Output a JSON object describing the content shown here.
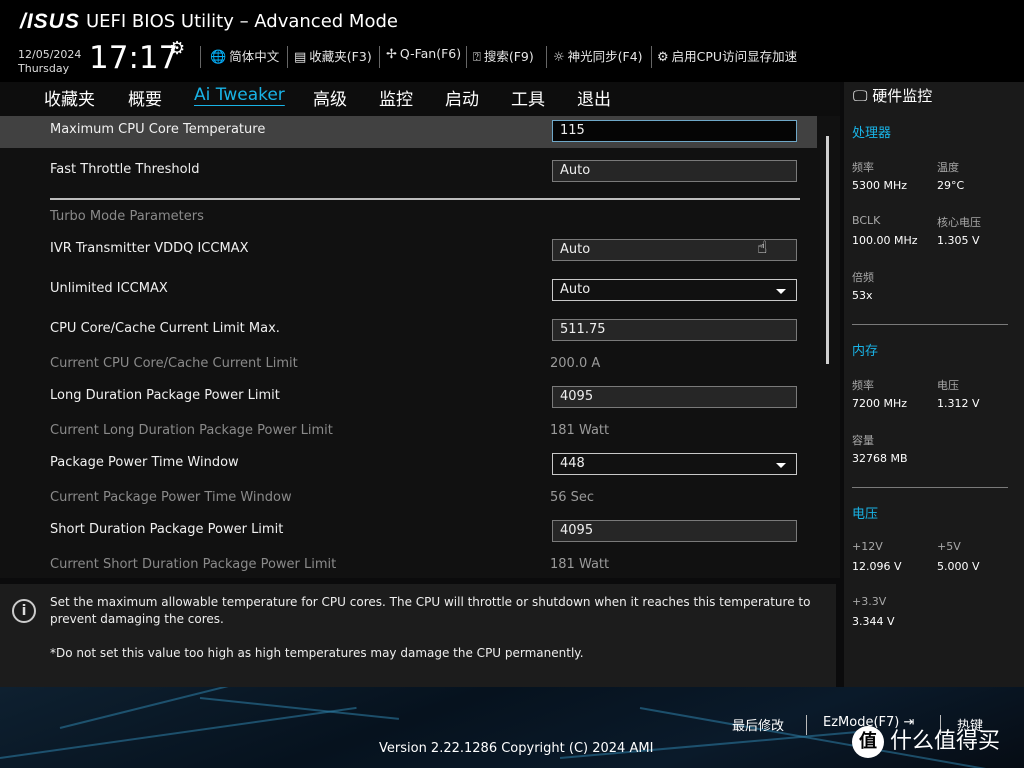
{
  "header": {
    "brand": "/ISUS",
    "title": "UEFI BIOS Utility – Advanced Mode",
    "date": "12/05/2024",
    "day": "Thursday",
    "time": "17:17",
    "tools": [
      {
        "icon": "globe-icon",
        "label": "简体中文"
      },
      {
        "icon": "favorites-icon",
        "label": "收藏夹(F3)"
      },
      {
        "icon": "fan-icon",
        "label": "Q-Fan(F6)"
      },
      {
        "icon": "help-search-icon",
        "label": "搜索(F9)"
      },
      {
        "icon": "aura-light-icon",
        "label": "神光同步(F4)"
      },
      {
        "icon": "resizable-bar-icon",
        "label": "启用CPU访问显存加速"
      }
    ]
  },
  "menu": {
    "items": [
      "收藏夹",
      "概要",
      "Ai Tweaker",
      "高级",
      "监控",
      "启动",
      "工具",
      "退出"
    ],
    "active": "Ai Tweaker"
  },
  "settings": {
    "rows": [
      {
        "label": "Maximum CPU Core Temperature",
        "value": "115"
      },
      {
        "label": "Fast Throttle Threshold",
        "value": "Auto"
      },
      {
        "label": "Turbo Mode Parameters"
      },
      {
        "label": "IVR Transmitter VDDQ ICCMAX",
        "value": "Auto"
      },
      {
        "label": "Unlimited ICCMAX",
        "value": "Auto"
      },
      {
        "label": "CPU Core/Cache Current Limit Max.",
        "value": "511.75"
      },
      {
        "label": "Current CPU Core/Cache Current Limit",
        "value": "200.0 A"
      },
      {
        "label": "Long Duration Package Power Limit",
        "value": "4095"
      },
      {
        "label": "Current Long Duration Package Power Limit",
        "value": "181 Watt"
      },
      {
        "label": "Package Power Time Window",
        "value": "448"
      },
      {
        "label": "Current Package Power Time Window",
        "value": "56 Sec"
      },
      {
        "label": "Short Duration Package Power Limit",
        "value": "4095"
      },
      {
        "label": "Current Short Duration Package Power Limit",
        "value": "181 Watt"
      }
    ]
  },
  "help": {
    "line1": "Set the maximum allowable temperature for CPU cores. The CPU will throttle or shutdown when it reaches this temperature to",
    "line2": "prevent damaging the cores.",
    "line3": "*Do not set this value too high as high temperatures may damage the CPU permanently."
  },
  "hardware": {
    "title": "硬件监控",
    "cpu": {
      "title": "处理器",
      "freq_label": "频率",
      "freq": "5300 MHz",
      "temp_label": "温度",
      "temp": "29°C",
      "bclk_label": "BCLK",
      "bclk": "100.00 MHz",
      "vcore_label": "核心电压",
      "vcore": "1.305 V",
      "ratio_label": "倍频",
      "ratio": "53x"
    },
    "memory": {
      "title": "内存",
      "freq_label": "频率",
      "freq": "7200 MHz",
      "volt_label": "电压",
      "volt": "1.312 V",
      "cap_label": "容量",
      "cap": "32768 MB"
    },
    "voltage": {
      "title": "电压",
      "v12_label": "+12V",
      "v12": "12.096 V",
      "v5_label": "+5V",
      "v5": "5.000 V",
      "v33_label": "+3.3V",
      "v33": "3.344 V"
    }
  },
  "footer": {
    "last_modified": "最后修改",
    "ezmode": "EzMode(F7)",
    "hotkeys": "热键",
    "version": "Version 2.22.1286 Copyright (C) 2024 AMI",
    "watermark": "什么值得买",
    "watermark_logo": "值"
  }
}
